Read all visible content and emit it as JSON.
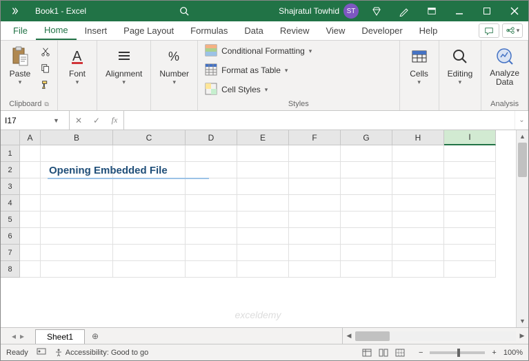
{
  "titlebar": {
    "title": "Book1  -  Excel",
    "user_name": "Shajratul Towhid",
    "user_initials": "ST"
  },
  "tabs": {
    "file": "File",
    "home": "Home",
    "insert": "Insert",
    "page_layout": "Page Layout",
    "formulas": "Formulas",
    "data": "Data",
    "review": "Review",
    "view": "View",
    "developer": "Developer",
    "help": "Help"
  },
  "ribbon": {
    "clipboard": {
      "label": "Clipboard",
      "paste": "Paste"
    },
    "font": {
      "label": "Font"
    },
    "alignment": {
      "label": "Alignment"
    },
    "number": {
      "label": "Number"
    },
    "styles": {
      "label": "Styles",
      "conditional": "Conditional Formatting",
      "table": "Format as Table",
      "cell": "Cell Styles"
    },
    "cells": {
      "label": "Cells"
    },
    "editing": {
      "label": "Editing"
    },
    "analysis": {
      "label": "Analysis",
      "analyze": "Analyze\nData"
    }
  },
  "formula_bar": {
    "name_box": "I17",
    "formula": ""
  },
  "grid": {
    "columns": [
      "A",
      "B",
      "C",
      "D",
      "E",
      "F",
      "G",
      "H",
      "I"
    ],
    "rows": [
      "1",
      "2",
      "3",
      "4",
      "5",
      "6",
      "7",
      "8"
    ],
    "content_b2": "Opening Embedded File",
    "active_col": "I"
  },
  "sheet_tabs": {
    "sheet1": "Sheet1"
  },
  "status": {
    "ready": "Ready",
    "accessibility": "Accessibility: Good to go",
    "zoom": "100%"
  },
  "watermark": "exceldemy"
}
